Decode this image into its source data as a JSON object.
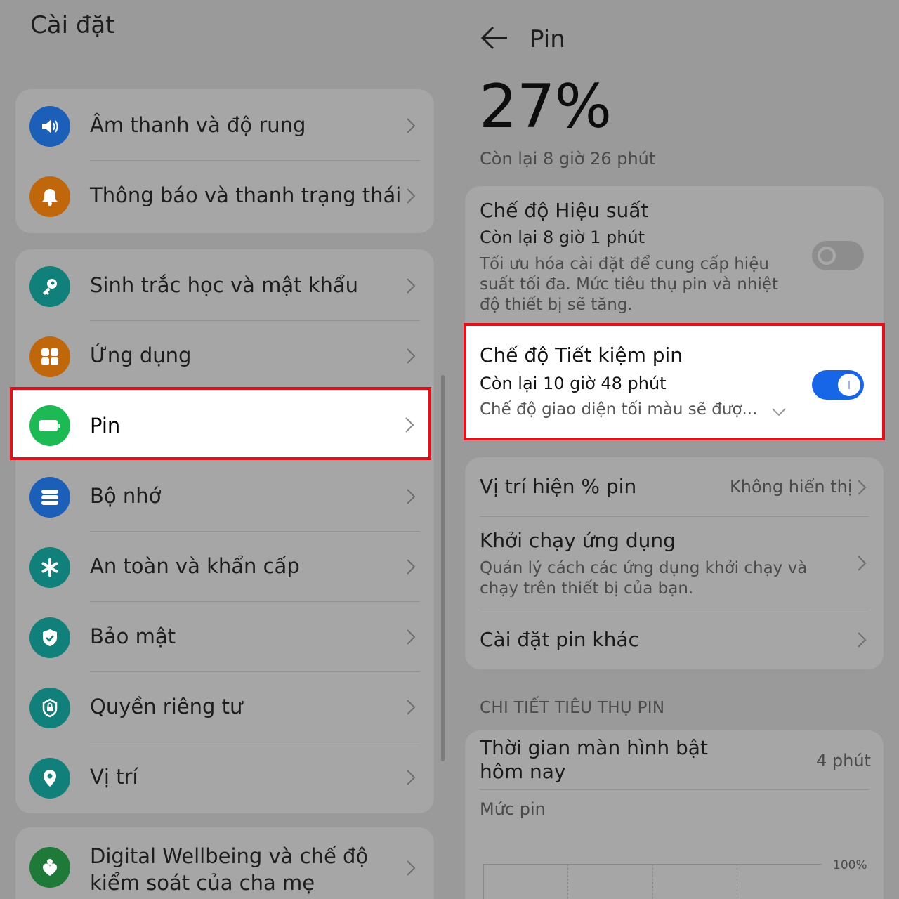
{
  "left": {
    "title": "Cài đặt",
    "group1": [
      {
        "label": "Âm thanh và độ rung",
        "icon": "speaker-icon",
        "color": "#1c5fb8"
      },
      {
        "label": "Thông báo và thanh trạng thái",
        "icon": "bell-icon",
        "color": "#c0670c"
      }
    ],
    "group2": [
      {
        "label": "Sinh trắc học và mật khẩu",
        "icon": "key-icon",
        "color": "#12807a"
      },
      {
        "label": "Ứng dụng",
        "icon": "apps-grid-icon",
        "color": "#c0670c"
      },
      {
        "label": "Pin",
        "icon": "battery-icon",
        "color": "#1db954"
      },
      {
        "label": "Bộ nhớ",
        "icon": "storage-icon",
        "color": "#1c5fb8"
      },
      {
        "label": "An toàn và khẩn cấp",
        "icon": "asterisk-icon",
        "color": "#12807a"
      },
      {
        "label": "Bảo mật",
        "icon": "shield-icon",
        "color": "#12807a"
      },
      {
        "label": "Quyền riêng tư",
        "icon": "privacy-lock-icon",
        "color": "#12807a"
      },
      {
        "label": "Vị trí",
        "icon": "location-pin-icon",
        "color": "#12807a"
      }
    ],
    "group3": [
      {
        "label_line1": "Digital Wellbeing và chế độ",
        "label_line2": "kiểm soát của cha mẹ",
        "icon": "heart-person-icon",
        "color": "#1f7a3a"
      }
    ]
  },
  "right": {
    "title": "Pin",
    "battery_percent": "27%",
    "remaining": "Còn lại 8 giờ 26 phút",
    "performance": {
      "title": "Chế độ Hiệu suất",
      "remaining": "Còn lại 8 giờ 1 phút",
      "description": "Tối ưu hóa cài đặt để cung cấp hiệu suất tối đa. Mức tiêu thụ pin và nhiệt độ thiết bị sẽ tăng.",
      "enabled": false
    },
    "saver": {
      "title": "Chế độ Tiết kiệm pin",
      "remaining": "Còn lại 10 giờ 48 phút",
      "description": "Chế độ giao diện tối màu sẽ đượ...",
      "enabled": true,
      "accent": "#1766e8"
    },
    "battery_pct_position": {
      "label": "Vị trí hiện % pin",
      "value": "Không hiển thị"
    },
    "app_launch": {
      "label": "Khởi chạy ứng dụng",
      "description": "Quản lý cách các ứng dụng khởi chạy và chạy trên thiết bị của bạn."
    },
    "other_settings": {
      "label": "Cài đặt pin khác"
    },
    "usage_section": "CHI TIẾT TIÊU THỤ PIN",
    "screen_on": {
      "label_line1": "Thời gian màn hình bật",
      "label_line2": "hôm nay",
      "value": "4 phút"
    },
    "battery_level_label": "Mức pin",
    "chart_max_label": "100%"
  },
  "highlight_color": "#e3101c"
}
